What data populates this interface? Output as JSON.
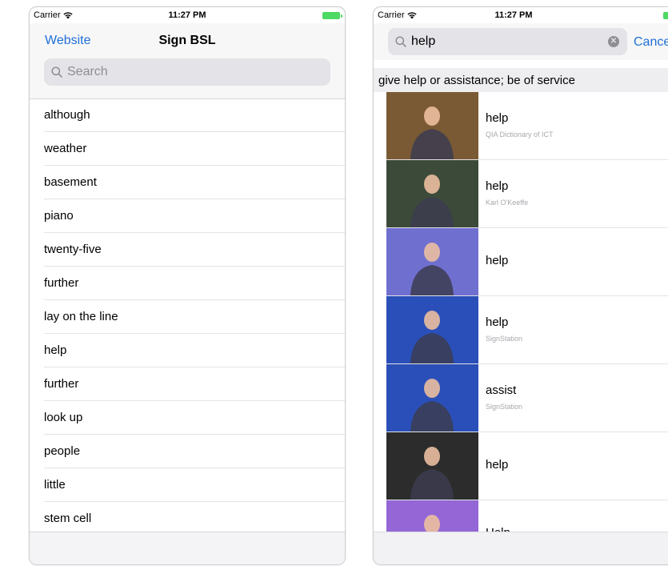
{
  "left": {
    "status": {
      "carrier": "Carrier",
      "time": "11:27 PM"
    },
    "nav": {
      "website": "Website",
      "title": "Sign BSL"
    },
    "search": {
      "placeholder": "Search"
    },
    "words": [
      "although",
      "weather",
      "basement",
      "piano",
      "twenty-five",
      "further",
      "lay on the line",
      "help",
      "further",
      "look up",
      "people",
      "little",
      "stem cell"
    ]
  },
  "right": {
    "status": {
      "carrier": "Carrier",
      "time": "11:27 PM"
    },
    "search": {
      "query": "help",
      "cancel": "Cancel"
    },
    "section_header": "give help or assistance; be of service",
    "results": [
      {
        "word": "help",
        "source": "QIA Dictionary of ICT",
        "bg": "#7a5a34"
      },
      {
        "word": "help",
        "source": "Karl O'Keeffe",
        "bg": "#3c4a3a"
      },
      {
        "word": "help",
        "source": "",
        "bg": "#6f6fd0"
      },
      {
        "word": "help",
        "source": "SignStation",
        "bg": "#2a4fb8"
      },
      {
        "word": "assist",
        "source": "SignStation",
        "bg": "#2a4fb8"
      },
      {
        "word": "help",
        "source": "",
        "bg": "#2c2c2c"
      },
      {
        "word": "Help",
        "source": "",
        "bg": "#9466d6"
      }
    ]
  },
  "colors": {
    "accent": "#1f6fd6",
    "battery": "#4cd964"
  }
}
